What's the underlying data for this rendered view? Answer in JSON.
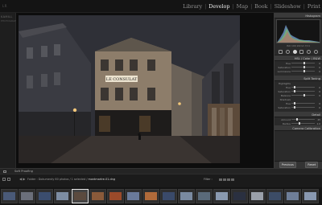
{
  "app": {
    "logo_text": "LR"
  },
  "modules": [
    "Library",
    "Develop",
    "Map",
    "Book",
    "Slideshow",
    "Print"
  ],
  "active_module": "Develop",
  "left_strip": {
    "brand": "KAMILL",
    "brand_sub": "PHOTOGRAPHY"
  },
  "photo": {
    "sign_text": "LE CONSULAT",
    "colors": {
      "sky": "#2f3037",
      "building": "#8d7d6a",
      "street": "#2a2625",
      "lamp": "#f2c77a"
    }
  },
  "right_panel": {
    "histogram_header": "Histogram",
    "histogram_info": "ISO 100   24mm   f/11",
    "basic_header": "HSL / Color / B&W",
    "rows_a": [
      {
        "label": "Hue",
        "value": "0"
      },
      {
        "label": "Saturation",
        "value": "0"
      },
      {
        "label": "Luminance",
        "value": "0"
      }
    ],
    "split_header": "Split Toning",
    "rows_b": [
      {
        "label": "Highlights",
        "value": ""
      },
      {
        "label": "Hue",
        "value": "0"
      },
      {
        "label": "Saturation",
        "value": "0"
      },
      {
        "label": "Balance",
        "value": "0"
      },
      {
        "label": "Shadows",
        "value": ""
      },
      {
        "label": "Hue",
        "value": "0"
      },
      {
        "label": "Saturation",
        "value": "0"
      }
    ],
    "detail_header": "Detail",
    "rows_c": [
      {
        "label": "Amount",
        "value": "25"
      },
      {
        "label": "Radius",
        "value": "1.0"
      }
    ],
    "camera_header": "Camera Calibration",
    "buttons": {
      "previous": "Previous",
      "reset": "Reset"
    }
  },
  "toolbar": {
    "soft_proofing": "Soft Proofing"
  },
  "filmstrip": {
    "folder_prefix": "Folder : Dokumenty",
    "count": "60 photos",
    "selected_prefix": "/ 1 selected /",
    "selected_file": "montmartre-01.dng",
    "filter_label": "Filter :",
    "thumbs": [
      {
        "color": "#4a5a78",
        "selected": false
      },
      {
        "color": "#6b6f7a",
        "selected": false
      },
      {
        "color": "#3b4d6e",
        "selected": false
      },
      {
        "color": "#7d8da3",
        "selected": false
      },
      {
        "color": "#5b4a3e",
        "selected": true
      },
      {
        "color": "#8a5a3a",
        "selected": false
      },
      {
        "color": "#9a4a2a",
        "selected": false
      },
      {
        "color": "#6a7a9a",
        "selected": false
      },
      {
        "color": "#b06a3a",
        "selected": false
      },
      {
        "color": "#3a4a6a",
        "selected": false
      },
      {
        "color": "#7a8aa0",
        "selected": false
      },
      {
        "color": "#5a6a7a",
        "selected": false
      },
      {
        "color": "#8a9ab0",
        "selected": false
      },
      {
        "color": "#2a3040",
        "selected": false
      },
      {
        "color": "#9aa0aa",
        "selected": false
      },
      {
        "color": "#3c4c66",
        "selected": false
      },
      {
        "color": "#6e7e98",
        "selected": false
      },
      {
        "color": "#8898b0",
        "selected": false
      }
    ]
  }
}
